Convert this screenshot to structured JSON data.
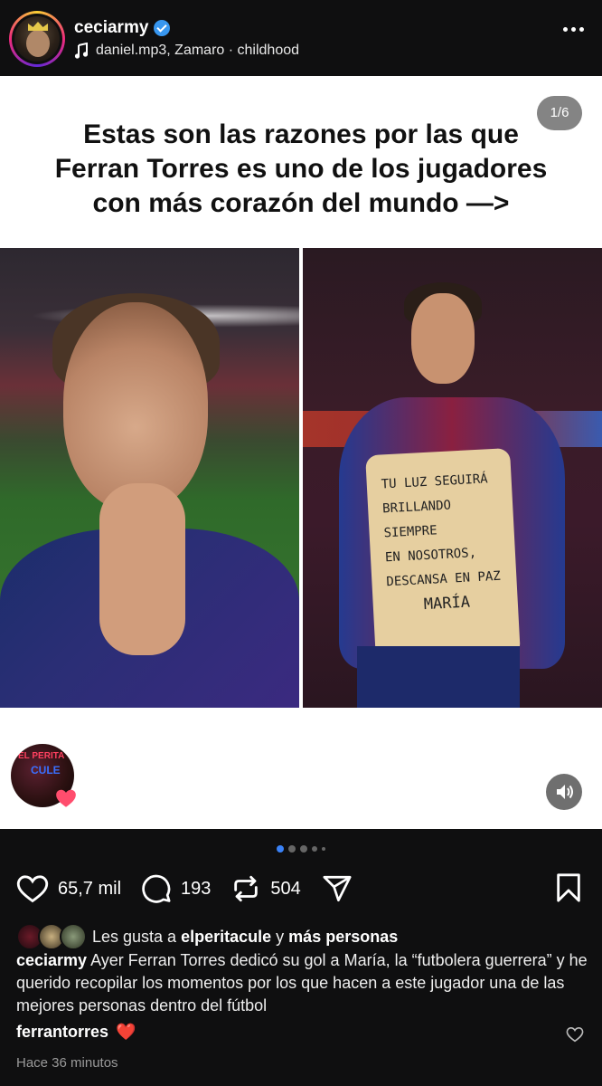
{
  "header": {
    "username": "ceciarmy",
    "audio": "daniel.mp3, Zamaro · childhood"
  },
  "post": {
    "headline_lines": [
      "Estas son las razones por las que",
      "Ferran Torres es uno de los jugadores",
      "con más corazón del mundo —>"
    ],
    "slide_counter": "1/6",
    "shirt_text": [
      "TU LUZ SEGUIRÁ",
      "BRILLANDO SIEMPRE",
      "EN NOSOTROS,",
      "DESCANSA EN PAZ",
      "MARÍA"
    ],
    "reel_avatar_text": [
      "EL PERITA",
      "CULE"
    ]
  },
  "carousel": {
    "total_dots": 5,
    "active_index": 0
  },
  "actions": {
    "likes": "65,7 mil",
    "comments": "193",
    "reposts": "504"
  },
  "liked_by": {
    "prefix": "Les gusta a",
    "user": "elperitacule",
    "connector": "y",
    "others": "más personas"
  },
  "caption": {
    "username": "ceciarmy",
    "text": "Ayer Ferran Torres dedicó su gol a María, la “futbolera guerrera” y he querido recopilar los momentos por los que hacen a este jugador una de las mejores personas dentro del fútbol"
  },
  "comment": {
    "username": "ferrantorres",
    "emoji": "❤️"
  },
  "timestamp": "Hace 36 minutos",
  "colors": {
    "background": "#0f0f10",
    "verified": "#3897f0",
    "active_dot": "#3a82f7",
    "heart_badge": "#ff4d6d"
  },
  "icons": [
    "more-icon",
    "music-note-icon",
    "verified-icon",
    "heart-icon",
    "comment-icon",
    "repost-icon",
    "share-icon",
    "bookmark-icon",
    "sound-icon"
  ]
}
